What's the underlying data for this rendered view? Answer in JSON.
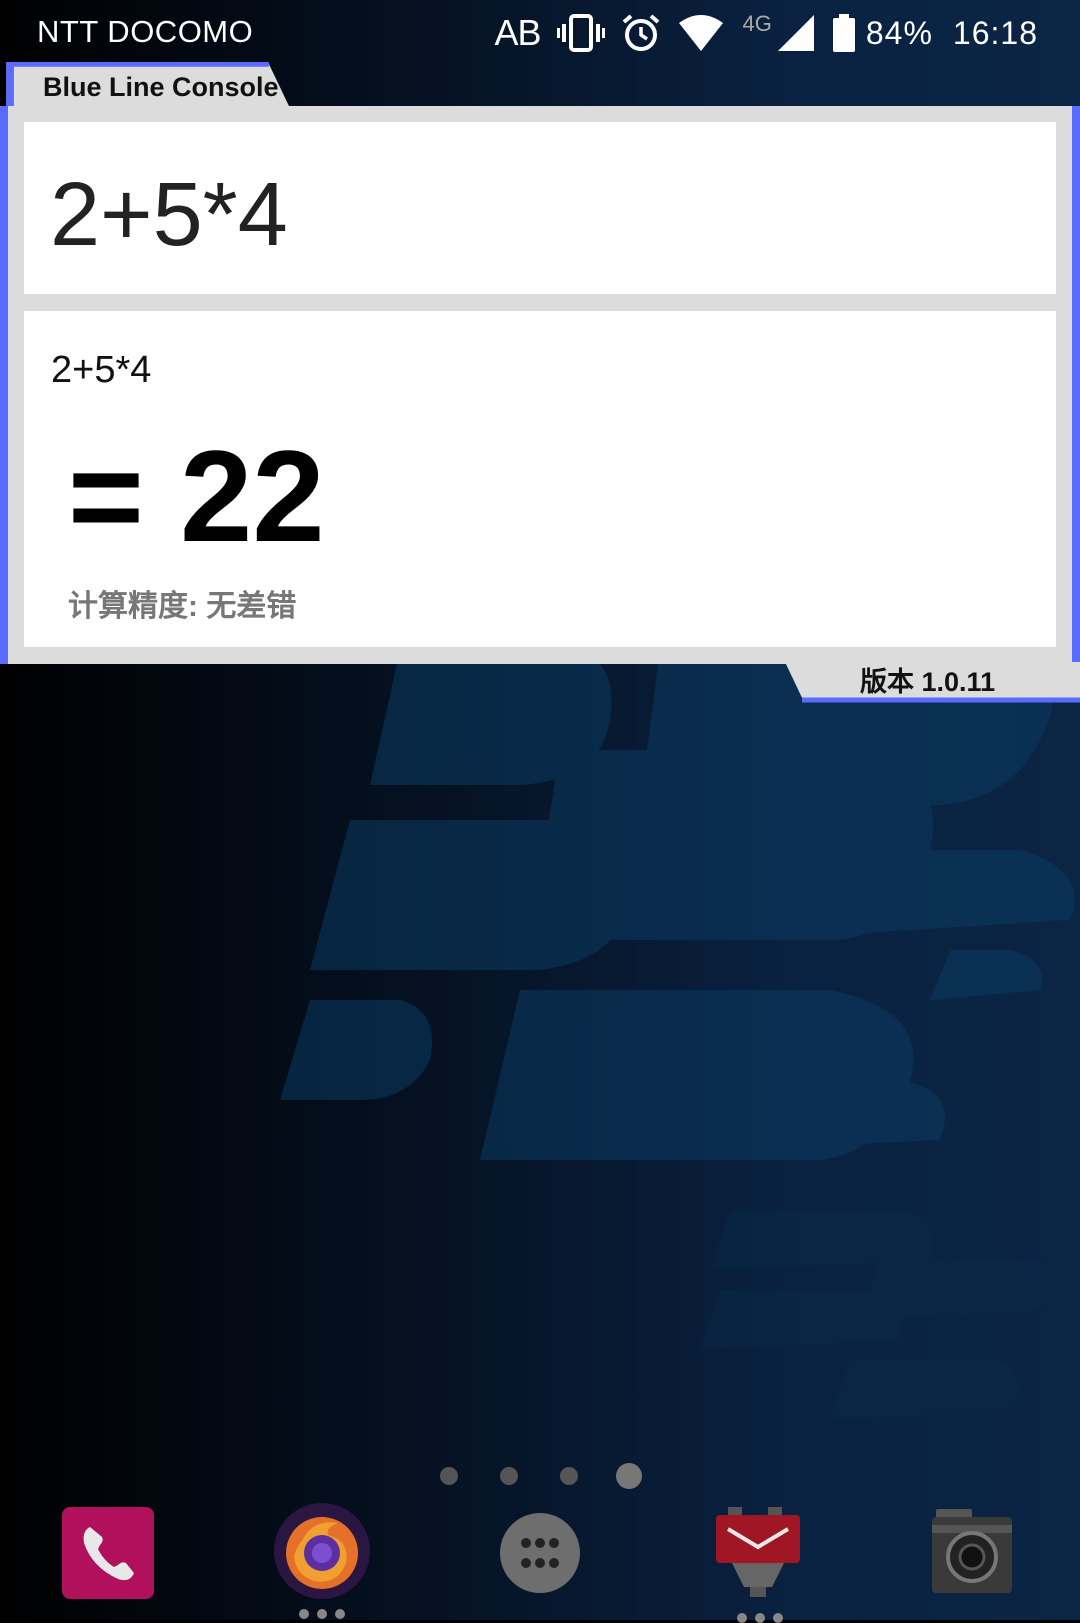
{
  "status_bar": {
    "carrier": "NTT DOCOMO",
    "ab_indicator": "AB",
    "network_type": "4G",
    "battery_percent": "84%",
    "time": "16:18",
    "icons": [
      "vibrate-icon",
      "alarm-icon",
      "wifi-icon",
      "signal-icon",
      "battery-icon"
    ]
  },
  "console": {
    "title": "Blue Line Console",
    "input": "2+5*4",
    "result_expression": "2+5*4",
    "result_value": "= 22",
    "precision_text": "计算精度: 无差错",
    "version": "版本 1.0.11",
    "accent_color": "#5a6cff"
  },
  "home": {
    "page_count": 4,
    "active_page": 4
  },
  "dock": {
    "apps": [
      {
        "name": "phone-app-icon",
        "color": "#b0105c"
      },
      {
        "name": "firefox-app-icon",
        "color": "#6b2fb5"
      },
      {
        "name": "app-drawer-icon",
        "color": "#777777"
      },
      {
        "name": "email-app-icon",
        "color": "#a01625"
      },
      {
        "name": "camera-app-icon",
        "color": "#333333"
      }
    ]
  }
}
